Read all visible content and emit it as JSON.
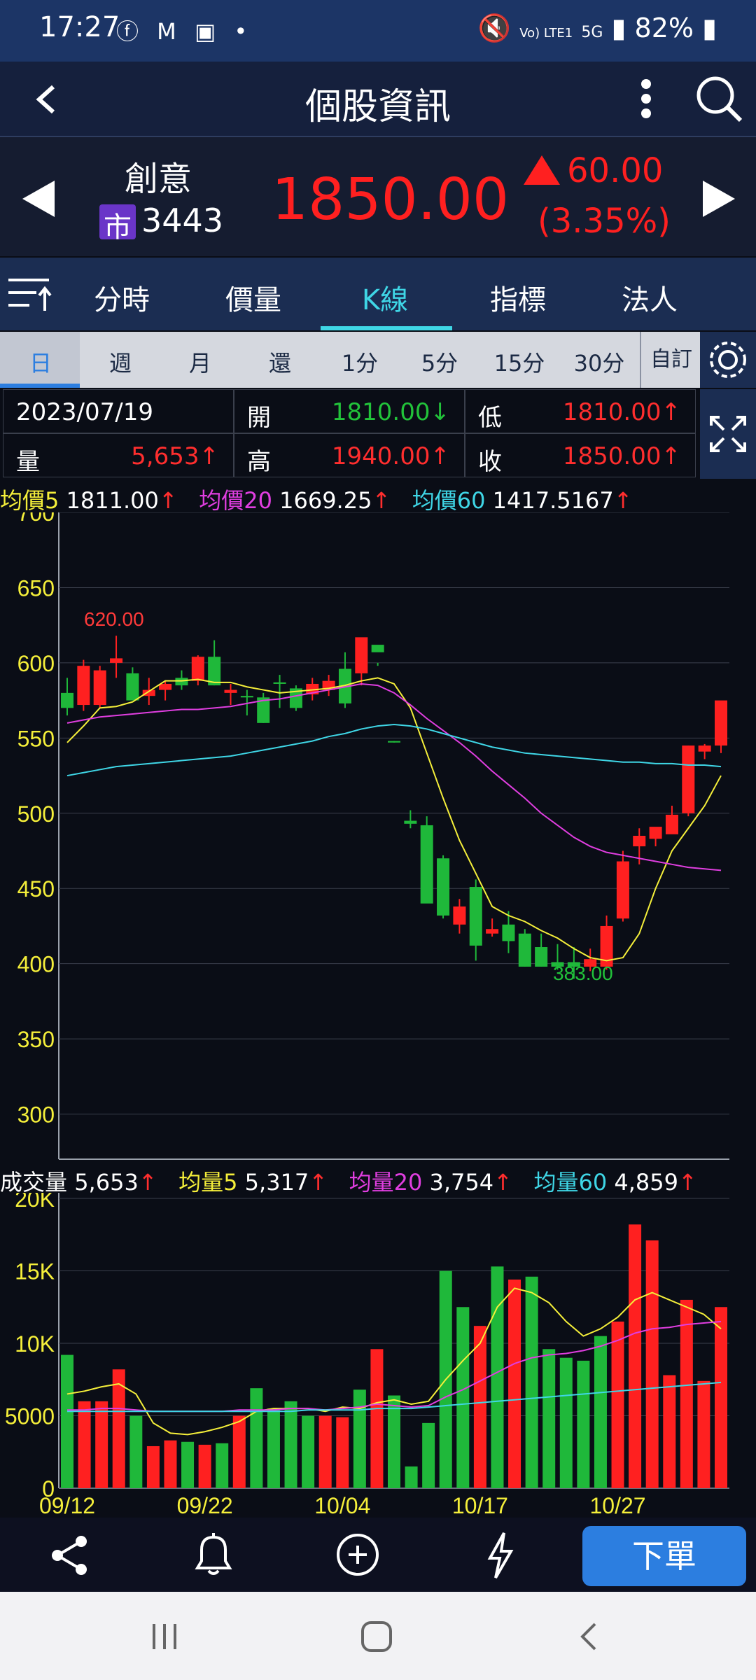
{
  "status_bar": {
    "time": "17:27",
    "network": "Vo) LTE1",
    "signal": "5G",
    "battery": "82%"
  },
  "header": {
    "title": "個股資訊"
  },
  "stock": {
    "name": "創意",
    "market_badge": "市",
    "code": "3443",
    "price": "1850.00",
    "change": "60.00",
    "change_pct": "(3.35%)"
  },
  "tabs": [
    "分時",
    "價量",
    "K線",
    "指標",
    "法人"
  ],
  "active_tab": "K線",
  "periods": [
    "日",
    "週",
    "月",
    "還",
    "1分",
    "5分",
    "15分",
    "30分"
  ],
  "custom_label": "自訂",
  "info": {
    "date": "2023/07/19",
    "open_label": "開",
    "open": "1810.00↓",
    "low_label": "低",
    "low": "1810.00↑",
    "volume_label": "量",
    "volume": "5,653↑",
    "high_label": "高",
    "high": "1940.00↑",
    "close_label": "收",
    "close": "1850.00↑"
  },
  "ma_legend": [
    {
      "label": "均價5",
      "value": "1811.00",
      "color": "#f5ef3a"
    },
    {
      "label": "均價20",
      "value": "1669.25",
      "color": "#e03ee0"
    },
    {
      "label": "均價60",
      "value": "1417.5167",
      "color": "#3fd6e6"
    }
  ],
  "vol_legend": {
    "title": "成交量",
    "value": "5,653",
    "items": [
      {
        "label": "均量5",
        "value": "5,317",
        "color": "#f5ef3a"
      },
      {
        "label": "均量20",
        "value": "3,754",
        "color": "#e03ee0"
      },
      {
        "label": "均量60",
        "value": "4,859",
        "color": "#3fd6e6"
      }
    ]
  },
  "bottom_action": "下單",
  "colors": {
    "up": "#ff2020",
    "down": "#1fb83a",
    "accent": "#2c7ee0"
  },
  "chart_data": {
    "type": "candlestick",
    "price_axis_ticks": [
      "700",
      "650",
      "600",
      "550",
      "500",
      "450",
      "400",
      "350",
      "300"
    ],
    "ylim": [
      270,
      700
    ],
    "volume_axis_ticks": [
      "20K",
      "15K",
      "10K",
      "5000",
      "0"
    ],
    "volume_ylim": [
      0,
      20000
    ],
    "date_labels": [
      "09/12",
      "09/22",
      "10/04",
      "10/17",
      "10/27"
    ],
    "date_label_index": [
      0,
      8,
      16,
      24,
      32
    ],
    "annotations": {
      "high_label": "620.00",
      "low_label": "383.00"
    },
    "candles": [
      [
        580,
        590,
        565,
        570
      ],
      [
        572,
        602,
        568,
        598
      ],
      [
        572,
        598,
        570,
        595
      ],
      [
        600,
        618,
        590,
        603
      ],
      [
        593,
        597,
        575,
        575
      ],
      [
        578,
        590,
        572,
        582
      ],
      [
        582,
        588,
        575,
        586
      ],
      [
        590,
        595,
        582,
        585
      ],
      [
        588,
        605,
        585,
        604
      ],
      [
        604,
        615,
        585,
        585
      ],
      [
        580,
        586,
        572,
        582
      ],
      [
        578,
        582,
        565,
        577
      ],
      [
        577,
        580,
        560,
        560
      ],
      [
        587,
        592,
        570,
        586
      ],
      [
        583,
        585,
        568,
        570
      ],
      [
        579,
        590,
        575,
        586
      ],
      [
        582,
        592,
        578,
        588
      ],
      [
        596,
        607,
        570,
        573
      ],
      [
        593,
        615,
        585,
        617
      ],
      [
        612,
        600,
        598,
        607
      ],
      [
        548,
        548,
        547,
        547
      ],
      [
        495,
        502,
        490,
        493
      ],
      [
        492,
        498,
        442,
        440
      ],
      [
        470,
        472,
        430,
        432
      ],
      [
        426,
        443,
        420,
        438
      ],
      [
        451,
        456,
        402,
        412
      ],
      [
        420,
        430,
        418,
        423
      ],
      [
        426,
        435,
        407,
        415
      ],
      [
        420,
        423,
        398,
        398
      ],
      [
        411,
        420,
        398,
        398
      ],
      [
        401,
        413,
        396,
        398
      ],
      [
        401,
        411,
        390,
        398
      ],
      [
        398,
        410,
        395,
        403
      ],
      [
        398,
        432,
        396,
        425
      ],
      [
        430,
        475,
        428,
        468
      ],
      [
        478,
        490,
        466,
        485
      ],
      [
        483,
        490,
        478,
        491
      ],
      [
        486,
        505,
        488,
        499
      ],
      [
        500,
        545,
        498,
        545
      ],
      [
        541,
        546,
        536,
        545
      ],
      [
        545,
        565,
        540,
        575
      ]
    ],
    "ma5": [
      547,
      558,
      570,
      571,
      574,
      581,
      588,
      588,
      589,
      587,
      587,
      584,
      582,
      580,
      581,
      582,
      583,
      585,
      588,
      590,
      586,
      570,
      540,
      510,
      482,
      460,
      438,
      432,
      428,
      422,
      417,
      410,
      404,
      402,
      404,
      420,
      450,
      475,
      490,
      505,
      525
    ],
    "ma20": [
      560,
      562,
      564,
      565,
      566,
      567,
      568,
      569,
      569,
      570,
      571,
      573,
      575,
      576,
      578,
      580,
      582,
      584,
      586,
      585,
      580,
      572,
      563,
      555,
      547,
      538,
      528,
      519,
      510,
      500,
      492,
      484,
      478,
      474,
      472,
      470,
      468,
      466,
      464,
      463,
      462
    ],
    "ma60": [
      525,
      527,
      529,
      531,
      532,
      533,
      534,
      535,
      536,
      537,
      538,
      540,
      542,
      544,
      546,
      548,
      551,
      553,
      556,
      558,
      559,
      558,
      556,
      553,
      550,
      547,
      544,
      542,
      540,
      539,
      538,
      537,
      536,
      535,
      534,
      534,
      533,
      533,
      532,
      532,
      531
    ],
    "volume": [
      9200,
      6000,
      6000,
      8200,
      5000,
      2900,
      3300,
      3200,
      3000,
      3100,
      5000,
      6900,
      5500,
      6000,
      5000,
      5000,
      4900,
      6800,
      9600,
      6400,
      1500,
      4500,
      15000,
      12500,
      11200,
      15300,
      14400,
      14600,
      9600,
      9000,
      8800,
      10500,
      11500,
      18200,
      17100,
      7800,
      13000,
      7400,
      12500
    ],
    "vol_ma5": [
      6500,
      6700,
      7000,
      7200,
      6500,
      4500,
      3800,
      3700,
      3900,
      4200,
      4600,
      5300,
      5500,
      5500,
      5500,
      5300,
      5600,
      5500,
      5900,
      6100,
      5800,
      6000,
      7500,
      8800,
      10000,
      12500,
      13800,
      13500,
      12800,
      11500,
      10500,
      11000,
      11800,
      13000,
      13500,
      13000,
      12500,
      12000,
      11000
    ],
    "vol_ma20": [
      5400,
      5400,
      5500,
      5500,
      5400,
      5300,
      5300,
      5300,
      5300,
      5300,
      5400,
      5400,
      5400,
      5500,
      5500,
      5400,
      5500,
      5600,
      5800,
      5700,
      5600,
      5700,
      6300,
      6800,
      7400,
      8000,
      8600,
      9000,
      9200,
      9300,
      9500,
      9800,
      10200,
      10700,
      11000,
      11100,
      11300,
      11400,
      11500
    ],
    "vol_ma60": [
      5300,
      5300,
      5300,
      5300,
      5300,
      5300,
      5300,
      5300,
      5300,
      5300,
      5300,
      5300,
      5300,
      5300,
      5400,
      5400,
      5400,
      5400,
      5500,
      5500,
      5500,
      5600,
      5700,
      5800,
      5900,
      6000,
      6100,
      6200,
      6300,
      6400,
      6500,
      6600,
      6700,
      6800,
      6900,
      7000,
      7100,
      7200,
      7300
    ]
  }
}
